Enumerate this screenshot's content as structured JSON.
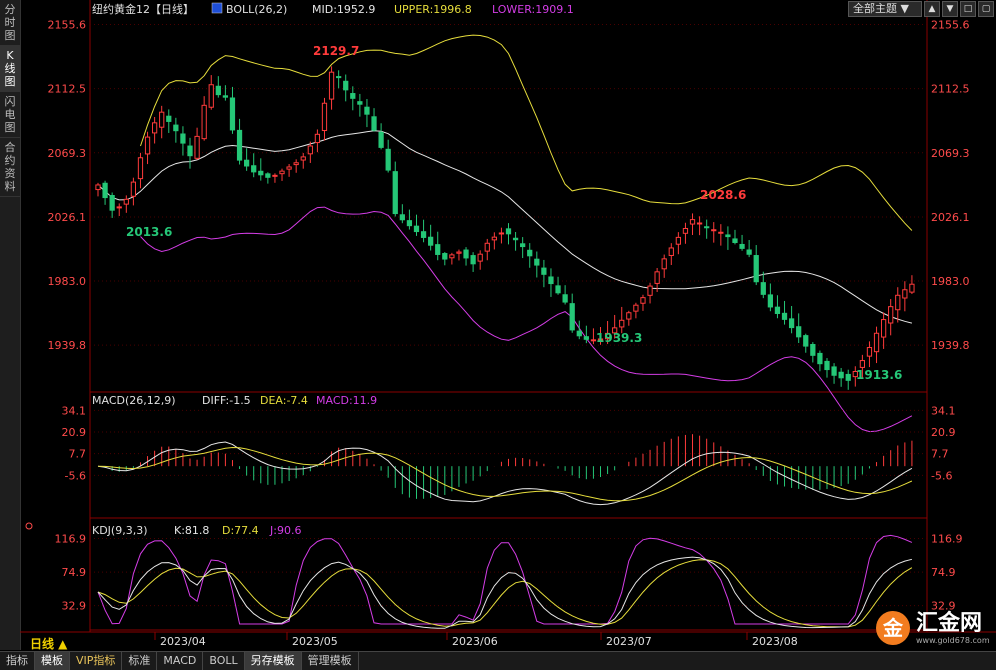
{
  "left_toolbar": {
    "tabs": [
      {
        "label": "分时图",
        "active": false
      },
      {
        "label": "K线图",
        "active": true
      },
      {
        "label": "闪电图",
        "active": false
      },
      {
        "label": "合约资料",
        "active": false
      }
    ]
  },
  "top_controls": {
    "theme_select": "全部主题",
    "buttons": [
      "▲",
      "▼",
      "□",
      "▢"
    ]
  },
  "colors": {
    "up": "#ff3b3b",
    "down": "#25c777",
    "upper": "#e6dd3c",
    "lower": "#d43de6",
    "mid": "#e6e6e6",
    "price_axis": "#ff4b4b",
    "grid": "#7a0000",
    "text": "#e0e0e0"
  },
  "main_panel": {
    "title": "纽约黄金12【日线】",
    "indicator": "BOLL(26,2)",
    "mid_label": "MID:1952.9",
    "upper_label": "UPPER:1996.8",
    "lower_label": "LOWER:1909.1",
    "y_ticks": [
      "2155.6",
      "2112.5",
      "2069.3",
      "2026.1",
      "1983.0",
      "1939.8"
    ],
    "annotations": {
      "high1": "2129.7",
      "low1": "2013.6",
      "low2": "1939.3",
      "high2": "2028.6",
      "low3": "1913.6"
    }
  },
  "macd_panel": {
    "title": "MACD(26,12,9)",
    "diff_label": "DIFF:-1.5",
    "dea_label": "DEA:-7.4",
    "macd_label": "MACD:11.9",
    "y_ticks": [
      "34.1",
      "20.9",
      "7.7",
      "-5.6"
    ]
  },
  "kdj_panel": {
    "title": "KDJ(9,3,3)",
    "k_label": "K:81.8",
    "d_label": "D:77.4",
    "j_label": "J:90.6",
    "y_ticks": [
      "116.9",
      "74.9",
      "32.9"
    ]
  },
  "x_axis": {
    "period_label": "日线 ▲",
    "labels": [
      "2023/04",
      "2023/05",
      "2023/06",
      "2023/07",
      "2023/08"
    ]
  },
  "bottom_tabs": [
    {
      "label": "指标",
      "active": false,
      "vip": false
    },
    {
      "label": "模板",
      "active": true,
      "vip": false
    },
    {
      "label": "VIP指标",
      "active": false,
      "vip": true
    },
    {
      "label": "标准",
      "active": false,
      "vip": false
    },
    {
      "label": "MACD",
      "active": false,
      "vip": false
    },
    {
      "label": "BOLL",
      "active": false,
      "vip": false
    },
    {
      "label": "另存模板",
      "active": true,
      "vip": false
    },
    {
      "label": "管理模板",
      "active": false,
      "vip": false
    }
  ],
  "logo": {
    "mark": "金",
    "name": "汇金网",
    "url": "www.gold678.com"
  },
  "chart_data": {
    "type": "candlestick",
    "y_range": [
      1913,
      2160
    ],
    "key_points": [
      {
        "label": "2013.6",
        "value": 2013.6,
        "kind": "low"
      },
      {
        "label": "2129.7",
        "value": 2129.7,
        "kind": "high"
      },
      {
        "label": "1939.3",
        "value": 1939.3,
        "kind": "low"
      },
      {
        "label": "2028.6",
        "value": 2028.6,
        "kind": "high"
      },
      {
        "label": "1913.6",
        "value": 1913.6,
        "kind": "low"
      }
    ],
    "close_anchors": [
      2050,
      2030,
      2040,
      2075,
      2095,
      2080,
      2060,
      2105,
      2120,
      2070,
      2060,
      2055,
      2060,
      2065,
      2080,
      2125,
      2105,
      2095,
      2070,
      2035,
      2025,
      2015,
      2000,
      2005,
      1995,
      2010,
      2015,
      2005,
      1990,
      1975,
      1960,
      1950,
      1948,
      1955,
      1965,
      1975,
      1995,
      2010,
      2022,
      2015,
      2010,
      2000,
      1990,
      1970,
      1960,
      1945,
      1930,
      1920,
      1915,
      1930,
      1950,
      1968,
      1975
    ]
  }
}
